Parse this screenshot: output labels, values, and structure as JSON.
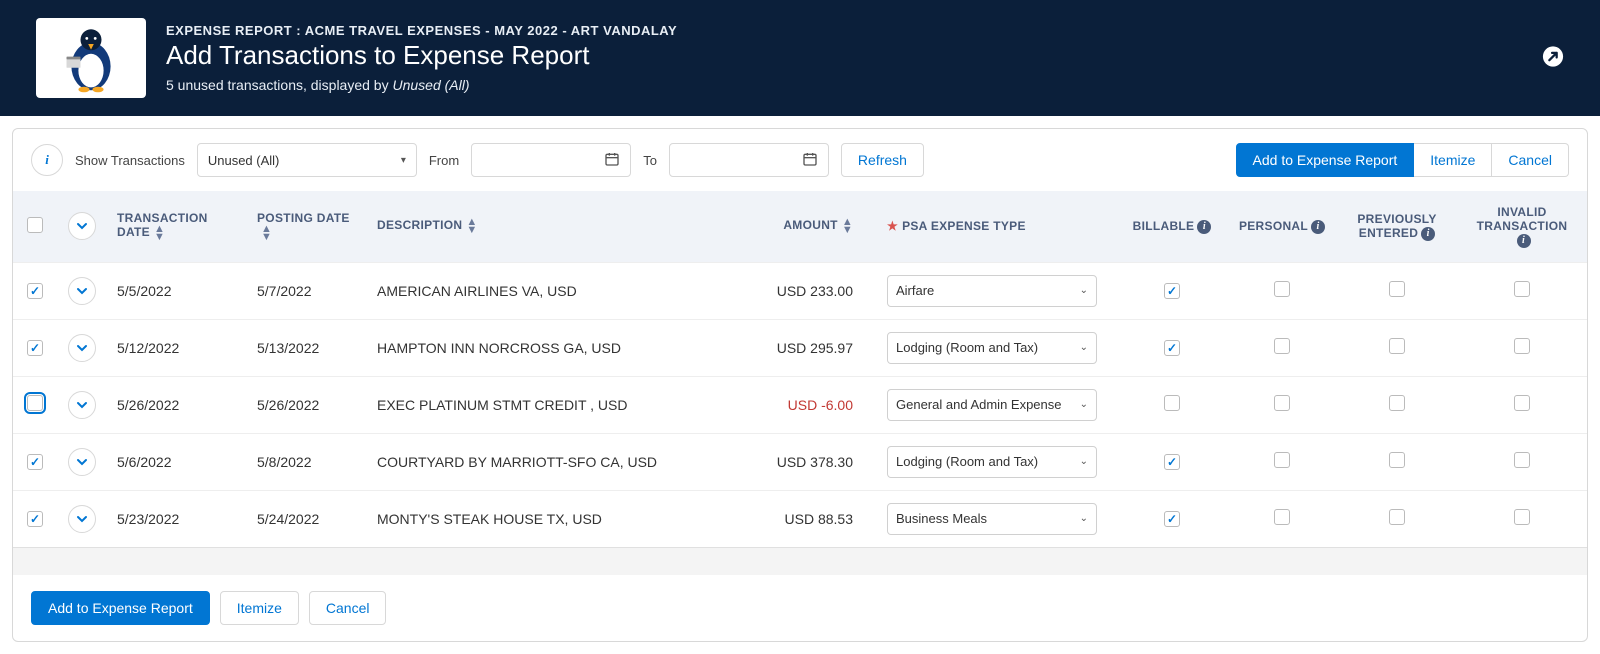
{
  "header": {
    "breadcrumb_prefix": "EXPENSE REPORT : ",
    "breadcrumb_value": "ACME TRAVEL EXPENSES - MAY 2022 - ART VANDALAY",
    "title": "Add Transactions to Expense Report",
    "sub_prefix": "5 unused transactions, displayed by ",
    "sub_em": "Unused (All)"
  },
  "toolbar": {
    "show_label": "Show Transactions",
    "show_value": "Unused (All)",
    "from_label": "From",
    "to_label": "To",
    "refresh": "Refresh",
    "add": "Add to Expense Report",
    "itemize": "Itemize",
    "cancel": "Cancel"
  },
  "columns": {
    "txn_date": "TRANSACTION DATE",
    "posting_date": "POSTING DATE",
    "description": "DESCRIPTION",
    "amount": "AMOUNT",
    "psa_type": "PSA EXPENSE TYPE",
    "billable": "BILLABLE",
    "personal": "PERSONAL",
    "prev_entered": "PREVIOUSLY ENTERED",
    "invalid": "INVALID TRANSACTION"
  },
  "rows": [
    {
      "checked": true,
      "focus": false,
      "txn": "5/5/2022",
      "post": "5/7/2022",
      "desc": "AMERICAN AIRLINES VA, USD",
      "amount": "USD 233.00",
      "neg": false,
      "type": "Airfare",
      "billable": true
    },
    {
      "checked": true,
      "focus": false,
      "txn": "5/12/2022",
      "post": "5/13/2022",
      "desc": "HAMPTON INN NORCROSS GA, USD",
      "amount": "USD 295.97",
      "neg": false,
      "type": "Lodging (Room and Tax)",
      "billable": true
    },
    {
      "checked": false,
      "focus": true,
      "txn": "5/26/2022",
      "post": "5/26/2022",
      "desc": "EXEC PLATINUM STMT CREDIT , USD",
      "amount": "USD -6.00",
      "neg": true,
      "type": "General and Admin Expense",
      "billable": false
    },
    {
      "checked": true,
      "focus": false,
      "txn": "5/6/2022",
      "post": "5/8/2022",
      "desc": "COURTYARD BY MARRIOTT-SFO CA, USD",
      "amount": "USD 378.30",
      "neg": false,
      "type": "Lodging (Room and Tax)",
      "billable": true
    },
    {
      "checked": true,
      "focus": false,
      "txn": "5/23/2022",
      "post": "5/24/2022",
      "desc": "MONTY'S STEAK HOUSE TX, USD",
      "amount": "USD 88.53",
      "neg": false,
      "type": "Business Meals",
      "billable": true
    }
  ],
  "footer": {
    "add": "Add to Expense Report",
    "itemize": "Itemize",
    "cancel": "Cancel"
  }
}
